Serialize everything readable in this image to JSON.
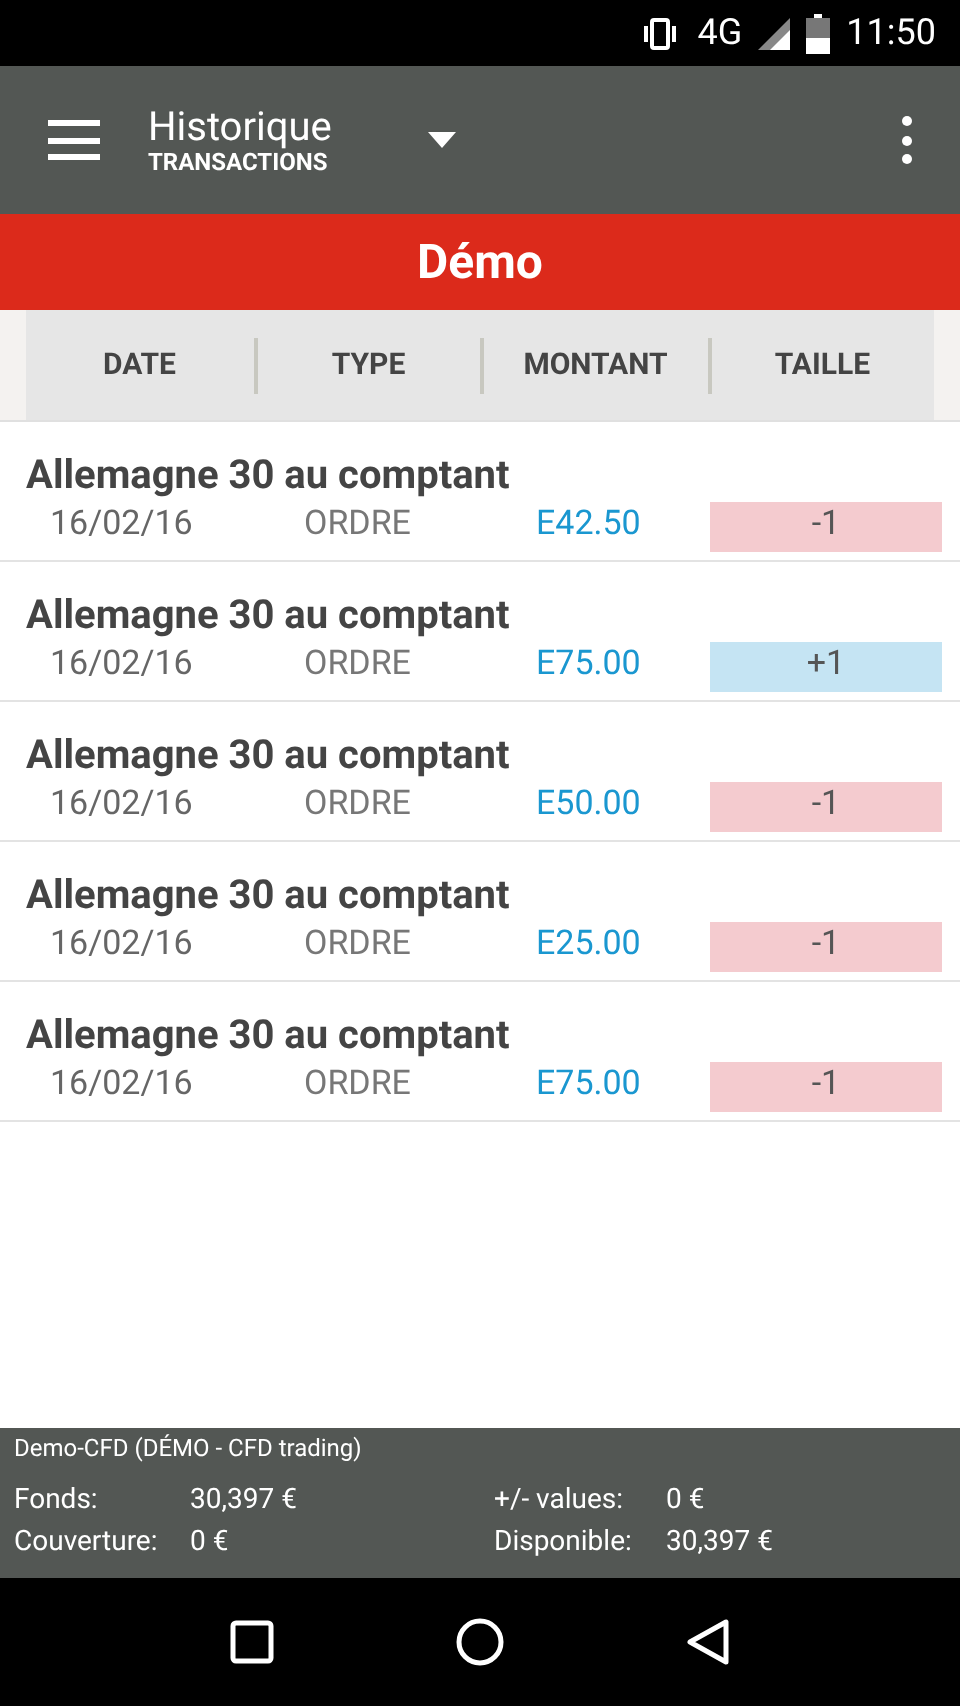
{
  "status_bar": {
    "network": "4G",
    "time": "11:50"
  },
  "toolbar": {
    "title": "Historique",
    "subtitle": "TRANSACTIONS"
  },
  "banner": "Démo",
  "table": {
    "columns": [
      "DATE",
      "TYPE",
      "MONTANT",
      "TAILLE"
    ],
    "rows": [
      {
        "name": "Allemagne 30 au comptant",
        "date": "16/02/16",
        "type": "ORDRE",
        "amount": "E42.50",
        "size": "-1",
        "kind": "sell"
      },
      {
        "name": "Allemagne 30 au comptant",
        "date": "16/02/16",
        "type": "ORDRE",
        "amount": "E75.00",
        "size": "+1",
        "kind": "buy"
      },
      {
        "name": "Allemagne 30 au comptant",
        "date": "16/02/16",
        "type": "ORDRE",
        "amount": "E50.00",
        "size": "-1",
        "kind": "sell"
      },
      {
        "name": "Allemagne 30 au comptant",
        "date": "16/02/16",
        "type": "ORDRE",
        "amount": "E25.00",
        "size": "-1",
        "kind": "sell"
      },
      {
        "name": "Allemagne 30 au comptant",
        "date": "16/02/16",
        "type": "ORDRE",
        "amount": "E75.00",
        "size": "-1",
        "kind": "sell"
      }
    ]
  },
  "footer": {
    "account": "Demo-CFD (DÉMO - CFD trading)",
    "fields": [
      {
        "label": "Fonds:",
        "value": "30,397 €"
      },
      {
        "label": "+/- values:",
        "value": "0 €"
      },
      {
        "label": "Couverture:",
        "value": "0 €"
      },
      {
        "label": "Disponible:",
        "value": "30,397 €"
      }
    ]
  }
}
